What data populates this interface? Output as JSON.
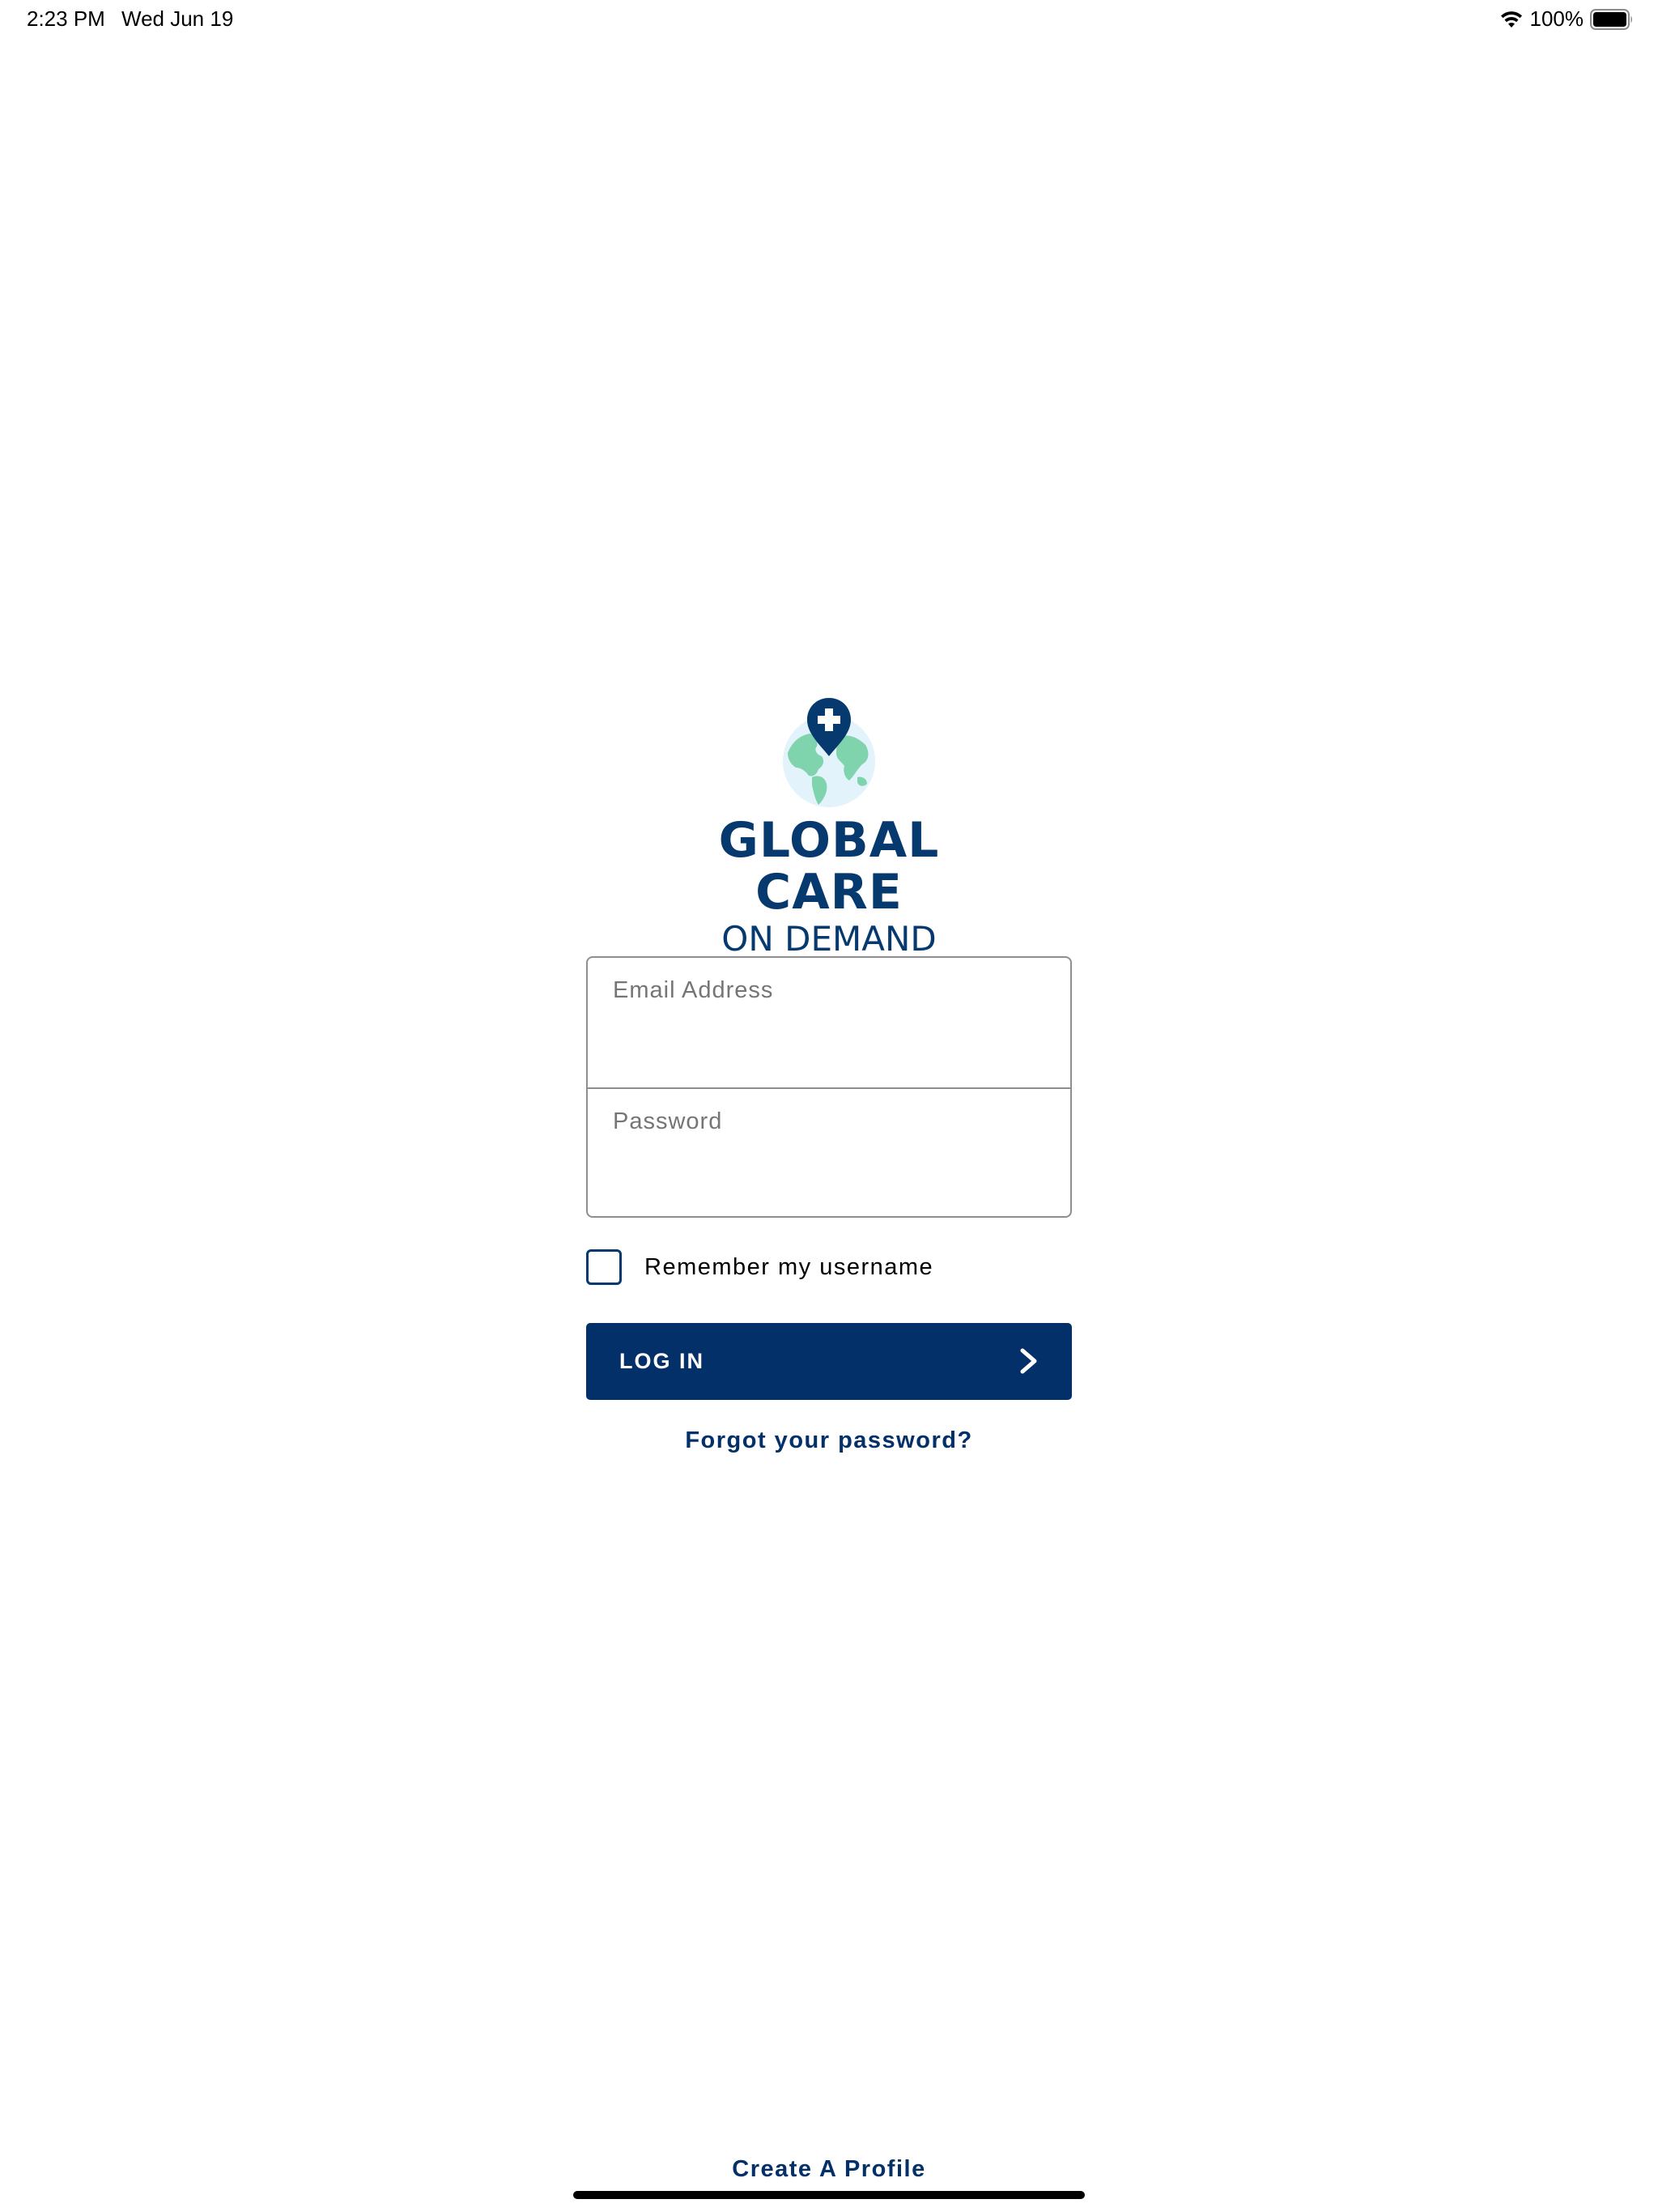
{
  "status_bar": {
    "time": "2:23 PM",
    "date": "Wed Jun 19",
    "battery_percent": "100%",
    "battery_level": 1.0,
    "icons": [
      "wifi-icon",
      "battery-icon"
    ]
  },
  "logo": {
    "title": "GLOBAL CARE",
    "subtitle": "ON DEMAND",
    "icon": "globe-pin-icon",
    "colors": {
      "navy": "#063a6e",
      "green": "#7fd3ad",
      "light_blue": "#e3f3fb"
    }
  },
  "login_form": {
    "email_placeholder": "Email Address",
    "email_value": "",
    "password_placeholder": "Password",
    "password_value": "",
    "remember_label": "Remember my username",
    "remember_checked": false,
    "login_label": "LOG IN",
    "login_icon": "chevron-right-icon",
    "forgot_label": "Forgot your password?"
  },
  "footer": {
    "create_profile_label": "Create A Profile"
  },
  "colors": {
    "primary": "#04306a",
    "border": "#8e8e8e",
    "placeholder": "#757575"
  }
}
